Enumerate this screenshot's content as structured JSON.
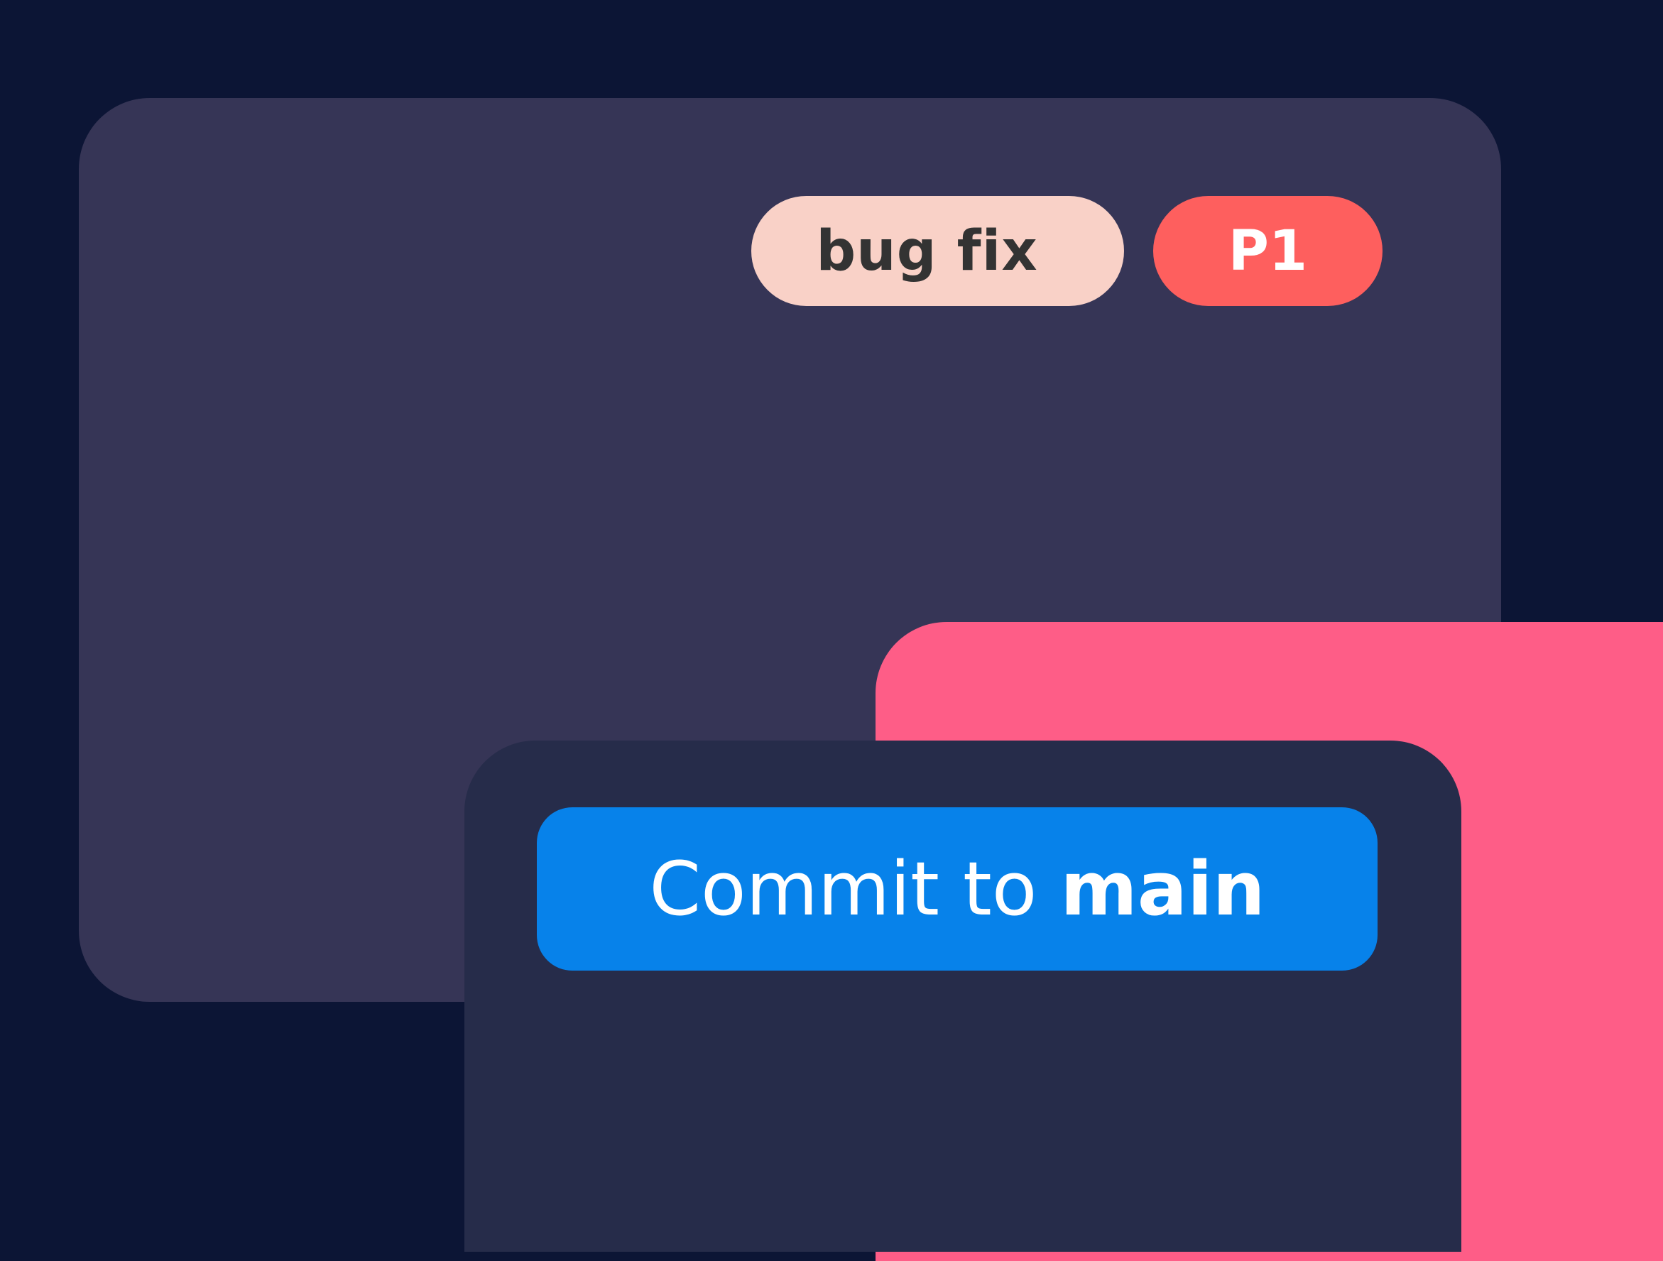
{
  "labels": {
    "type_label": "bug fix",
    "priority_label": "P1"
  },
  "commit": {
    "prefix": "Commit to ",
    "branch": "main"
  },
  "colors": {
    "background": "#0c1535",
    "back_panel": "#363556",
    "type_label_bg": "#f9d1c7",
    "priority_label_bg": "#fe5f5e",
    "accent_panel": "#fe5d87",
    "front_panel": "#262c4a",
    "commit_button": "#0782ea"
  }
}
